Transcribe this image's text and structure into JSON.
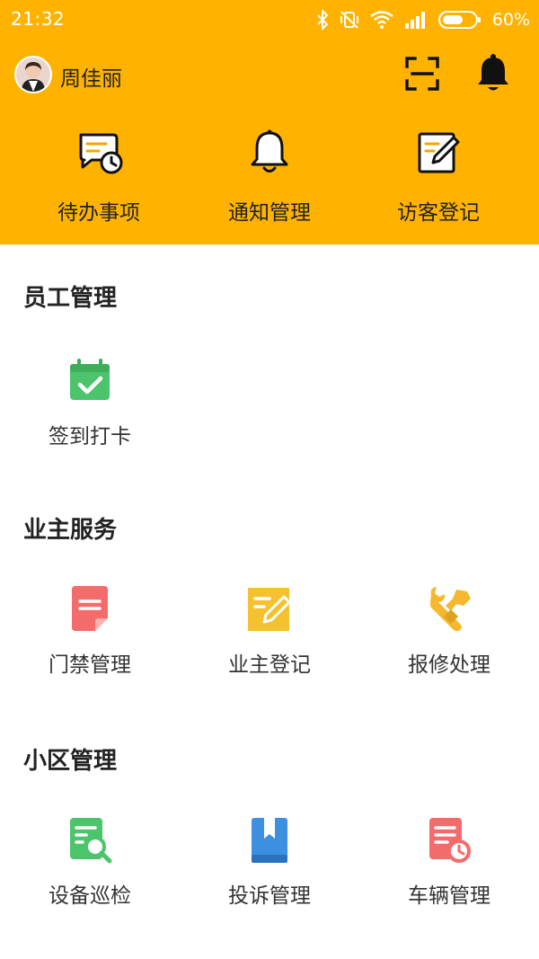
{
  "status_bar": {
    "time": "21:32",
    "battery_percent": "60%",
    "icons": [
      "bluetooth-icon",
      "vibrate-off-icon",
      "wifi-icon",
      "signal-icon",
      "battery-icon"
    ]
  },
  "user": {
    "name": "周佳丽",
    "avatar_icon": "avatar",
    "actions": [
      "scan-icon",
      "bell-icon"
    ]
  },
  "quick_actions": [
    {
      "label": "待办事项",
      "icon": "todo-clock-icon"
    },
    {
      "label": "通知管理",
      "icon": "bell-icon"
    },
    {
      "label": "访客登记",
      "icon": "edit-note-icon"
    }
  ],
  "sections": [
    {
      "title": "员工管理",
      "items": [
        {
          "label": "签到打卡",
          "icon": "calendar-check-icon",
          "color": "#4CC46B"
        }
      ]
    },
    {
      "title": "业主服务",
      "items": [
        {
          "label": "门禁管理",
          "icon": "document-icon",
          "color": "#F46B6B"
        },
        {
          "label": "业主登记",
          "icon": "edit-note-icon",
          "color": "#F5C12E"
        },
        {
          "label": "报修处理",
          "icon": "wrench-icon",
          "color": "#F5B82E"
        }
      ]
    },
    {
      "title": "小区管理",
      "items": [
        {
          "label": "设备巡检",
          "icon": "inspect-search-icon",
          "color": "#4CC46B"
        },
        {
          "label": "投诉管理",
          "icon": "book-icon",
          "color": "#3D8FE0"
        },
        {
          "label": "车辆管理",
          "icon": "doc-clock-icon",
          "color": "#F46B6B"
        }
      ]
    }
  ],
  "colors": {
    "header_bg": "#FFB300",
    "text_dark": "#222222"
  }
}
